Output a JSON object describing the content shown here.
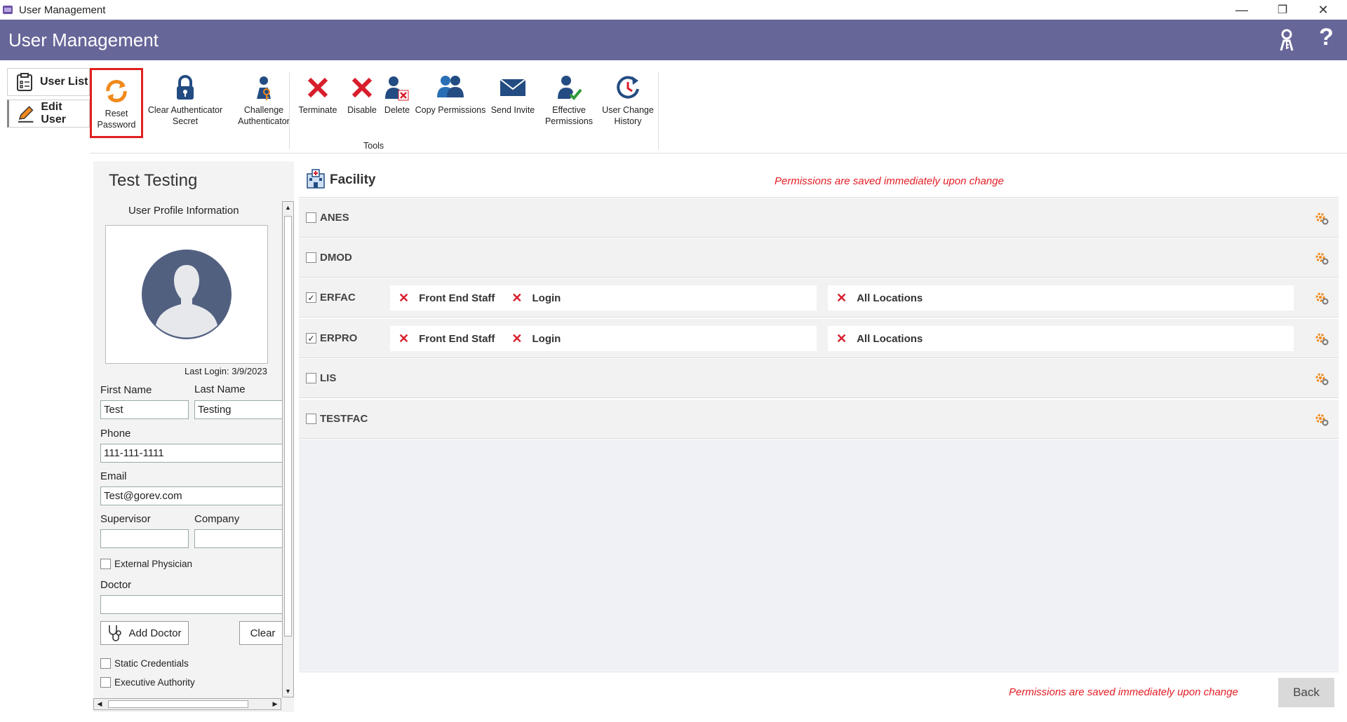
{
  "window": {
    "title": "User Management",
    "minimize": "—",
    "restore": "❐",
    "close": "✕"
  },
  "header": {
    "title": "User Management",
    "help": "?"
  },
  "side_tabs": [
    {
      "label": "User List"
    },
    {
      "label": "Edit User"
    }
  ],
  "toolbar": {
    "reset_password": [
      "Reset",
      "Password"
    ],
    "clear_auth_secret": [
      "Clear Authenticator",
      "Secret"
    ],
    "challenge_auth": [
      "Challenge",
      "Authenticator"
    ],
    "terminate": "Terminate",
    "disable": "Disable",
    "delete": "Delete",
    "copy_permissions": "Copy Permissions",
    "send_invite": "Send Invite",
    "effective_permissions": [
      "Effective",
      "Permissions"
    ],
    "user_change_history": [
      "User Change",
      "History"
    ],
    "group_label": "Tools"
  },
  "profile": {
    "name": "Test Testing",
    "section_title": "User Profile Information",
    "last_login": "Last Login: 3/9/2023",
    "first_name_label": "First Name",
    "first_name": "Test",
    "last_name_label": "Last Name",
    "last_name": "Testing",
    "phone_label": "Phone",
    "phone": "111-111-1111",
    "email_label": "Email",
    "email": "Test@gorev.com",
    "supervisor_label": "Supervisor",
    "supervisor": "",
    "company_label": "Company",
    "company": "",
    "external_physician_label": "External Physician",
    "doctor_label": "Doctor",
    "doctor": "",
    "add_doctor": "Add Doctor",
    "clear": "Clear",
    "static_credentials_label": "Static Credentials",
    "executive_authority_label": "Executive Authority"
  },
  "facility": {
    "title": "Facility",
    "notice_top": "Permissions are saved immediately upon change",
    "notice_bottom": "Permissions are saved immediately upon change",
    "back": "Back",
    "rows": [
      {
        "name": "ANES",
        "checked": false
      },
      {
        "name": "DMOD",
        "checked": false
      },
      {
        "name": "ERFAC",
        "checked": true,
        "role": "Front End Staff",
        "perm": "Login",
        "location": "All Locations"
      },
      {
        "name": "ERPRO",
        "checked": true,
        "role": "Front End Staff",
        "perm": "Login",
        "location": "All Locations"
      },
      {
        "name": "LIS",
        "checked": false
      },
      {
        "name": "TESTFAC",
        "checked": false
      }
    ]
  },
  "colors": {
    "header": "#676699",
    "accent_red": "#e31d24",
    "highlight_border": "#e02020"
  }
}
